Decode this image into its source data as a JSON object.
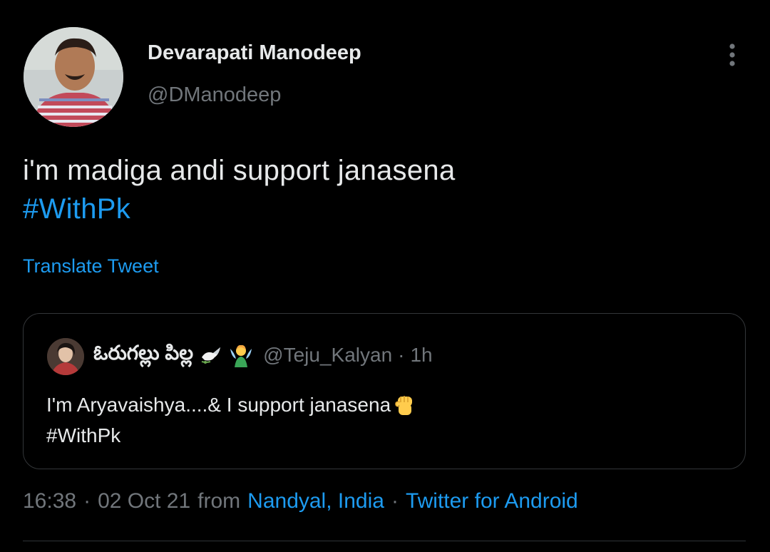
{
  "author": {
    "display_name": "Devarapati Manodeep",
    "handle": "@DManodeep",
    "avatar_icon": "profile-photo"
  },
  "tweet": {
    "text_line1": "i'm madiga andi support janasena",
    "hashtag": "#WithPk",
    "translate_label": "Translate Tweet"
  },
  "quoted_tweet": {
    "display_name": "ఓరుగల్లు పిల్ల",
    "name_emojis": [
      "dove-icon",
      "fairy-icon"
    ],
    "handle": "@Teju_Kalyan",
    "separator": "·",
    "time": "1h",
    "text_line1": "I'm Aryavaishya....& I support janasena",
    "text_emoji": "raised-fist-icon",
    "hashtag": "#WithPk"
  },
  "meta": {
    "time": "16:38",
    "date": "02 Oct 21",
    "from_label": "from",
    "location": "Nandyal, India",
    "source": "Twitter for Android",
    "separator": "·"
  },
  "colors": {
    "background": "#000000",
    "text_primary": "#e7e9ea",
    "text_secondary": "#71767b",
    "accent": "#1d9bf0",
    "border": "#333639"
  }
}
